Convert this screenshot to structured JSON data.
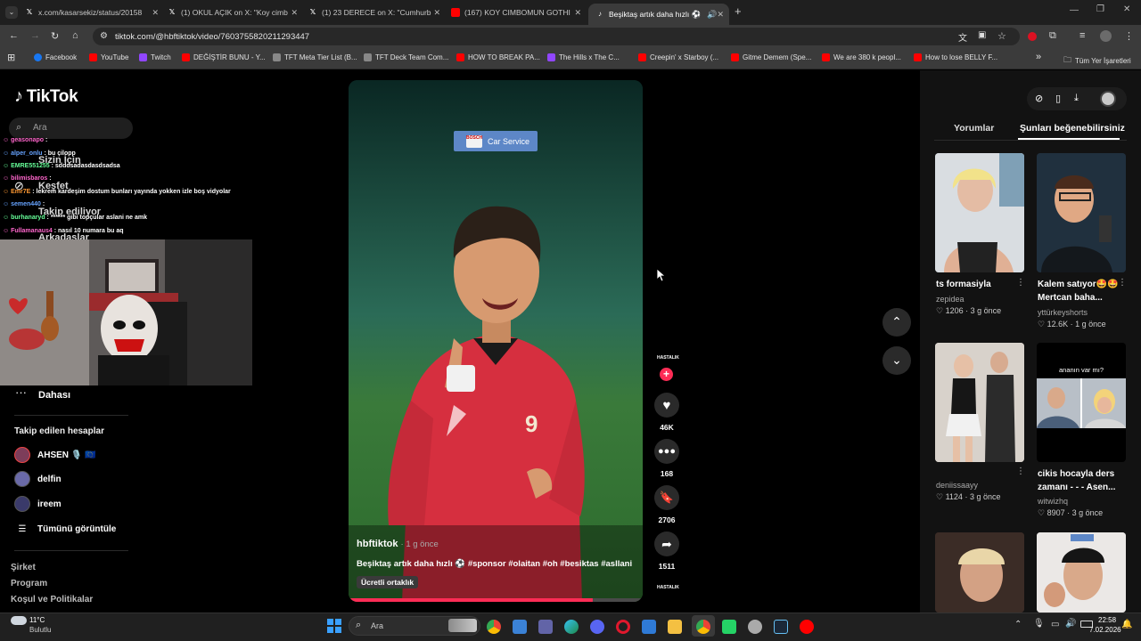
{
  "tabs": [
    {
      "label": "x.com/kasarsekiz/status/20158",
      "fav": "x-logo"
    },
    {
      "label": "(1) OKUL AÇIK on X: \"Koy cimb",
      "fav": "x-logo"
    },
    {
      "label": "(1) 23 DERECE on X: \"Cumhurb",
      "fav": "x-logo"
    },
    {
      "label": "(167) KOY CIMBOMUN GOTHI",
      "fav": "youtube-logo"
    },
    {
      "label": "Beşiktaş artık daha hızlı ⚽",
      "fav": "tiktok-logo",
      "active": true
    }
  ],
  "address": {
    "url": "tiktok.com/@hbftiktok/video/7603755820211293447"
  },
  "bookmarks": [
    {
      "label": "Facebook",
      "color": "#1877f2"
    },
    {
      "label": "YouTube",
      "color": "#ff0000"
    },
    {
      "label": "Twitch",
      "color": "#9146ff"
    },
    {
      "label": "DEĞİŞTİR BUNU - Y...",
      "color": "#ff0000"
    },
    {
      "label": "TFT Meta Tier List (B...",
      "color": "#888888"
    },
    {
      "label": "TFT Deck Team Com...",
      "color": "#888888"
    },
    {
      "label": "HOW TO BREAK PA...",
      "color": "#ff0000"
    },
    {
      "label": "The Hills x The C...",
      "color": "#9146ff"
    },
    {
      "label": "Creepin' x Starboy (...",
      "color": "#ff0000"
    },
    {
      "label": "Gitme Demem (Spe...",
      "color": "#ff0000"
    },
    {
      "label": "We are 380 k peopl...",
      "color": "#ff0000"
    },
    {
      "label": "How to lose BELLY F...",
      "color": "#ff0000"
    },
    {
      "label": "»",
      "color": ""
    },
    {
      "label": "Tüm Yer İşaretleri",
      "color": ""
    }
  ],
  "sidebar": {
    "logo": "TikTok",
    "search_placeholder": "Ara",
    "items": [
      "Sizin İçin",
      "Keşfet",
      "Takip ediliyor",
      "Arkadaşlar",
      "Dahası"
    ],
    "following_title": "Takip edilen hesaplar",
    "following": [
      {
        "name": "AHSEN 🎙️ 🇪🇺"
      },
      {
        "name": "delfin"
      },
      {
        "name": "ireem"
      }
    ],
    "show_all": "Tümünü görüntüle",
    "footer": [
      "Şirket",
      "Program",
      "Koşul ve Politikalar"
    ]
  },
  "chat": [
    {
      "user": "geasonapo",
      "msg": ":",
      "color": "#ff66cc"
    },
    {
      "user": "alper_onlu",
      "msg": ": bu çilopp",
      "color": "#66a3ff"
    },
    {
      "user": "EMRE551255",
      "msg": ": sdddsadasdasdsadsa",
      "color": "#66ff99"
    },
    {
      "user": "bilimisbaros",
      "msg": ":",
      "color": "#ff66cc"
    },
    {
      "user": "Emr7E",
      "msg": ": lekrem kardeşim dostum bunları yayında yokken izle boş vidyolar",
      "color": "#ff9933"
    },
    {
      "user": "semen440",
      "msg": ":",
      "color": "#66a3ff"
    },
    {
      "user": "burhanaryd",
      "msg": ": ****** gibi topçular aslani ne amk",
      "color": "#66ff99"
    },
    {
      "user": "Fullamanaus4",
      "msg": ": nasıl 10 numara bu aq",
      "color": "#ff66cc"
    }
  ],
  "video": {
    "ad_label": "Car Service",
    "author": "hbftiktok",
    "time": "· 1 g önce",
    "caption": "Beşiktaş artık daha hızlı ⚽ #sponsor #olaitan #oh #besiktas #asllani",
    "partner": "Ücretli ortaklık",
    "player_number": "9",
    "progress": 0.83
  },
  "actions": {
    "brand_top": "HASTALIK",
    "likes": "46K",
    "comments": "168",
    "saves": "2706",
    "shares": "1511",
    "brand_bottom": "HASTALIK"
  },
  "right": {
    "tabs": [
      "Yorumlar",
      "Şunları beğenebilirsiniz"
    ],
    "cards": [
      {
        "title": "ts formasiyla",
        "author": "zepidea",
        "likes": "1206",
        "time": "3 g önce"
      },
      {
        "title": "Kalem satıyor🤩🤩Mertcan baha...",
        "author": "yttürkeyshorts",
        "likes": "12.6K",
        "time": "1 g önce"
      },
      {
        "title": "",
        "author": "deniissaayy",
        "likes": "1124",
        "time": "3 g önce"
      },
      {
        "title": "cikis hocayla ders zamanı - - - Asen...",
        "author": "witwizhq",
        "likes": "8907",
        "time": "3 g önce"
      }
    ],
    "card4_overlay": "ananın var mı?"
  },
  "taskbar": {
    "weather_temp": "11°C",
    "weather_desc": "Bulutlu",
    "search_placeholder": "Ara",
    "time": "22:58",
    "date": "7.02.2026"
  }
}
